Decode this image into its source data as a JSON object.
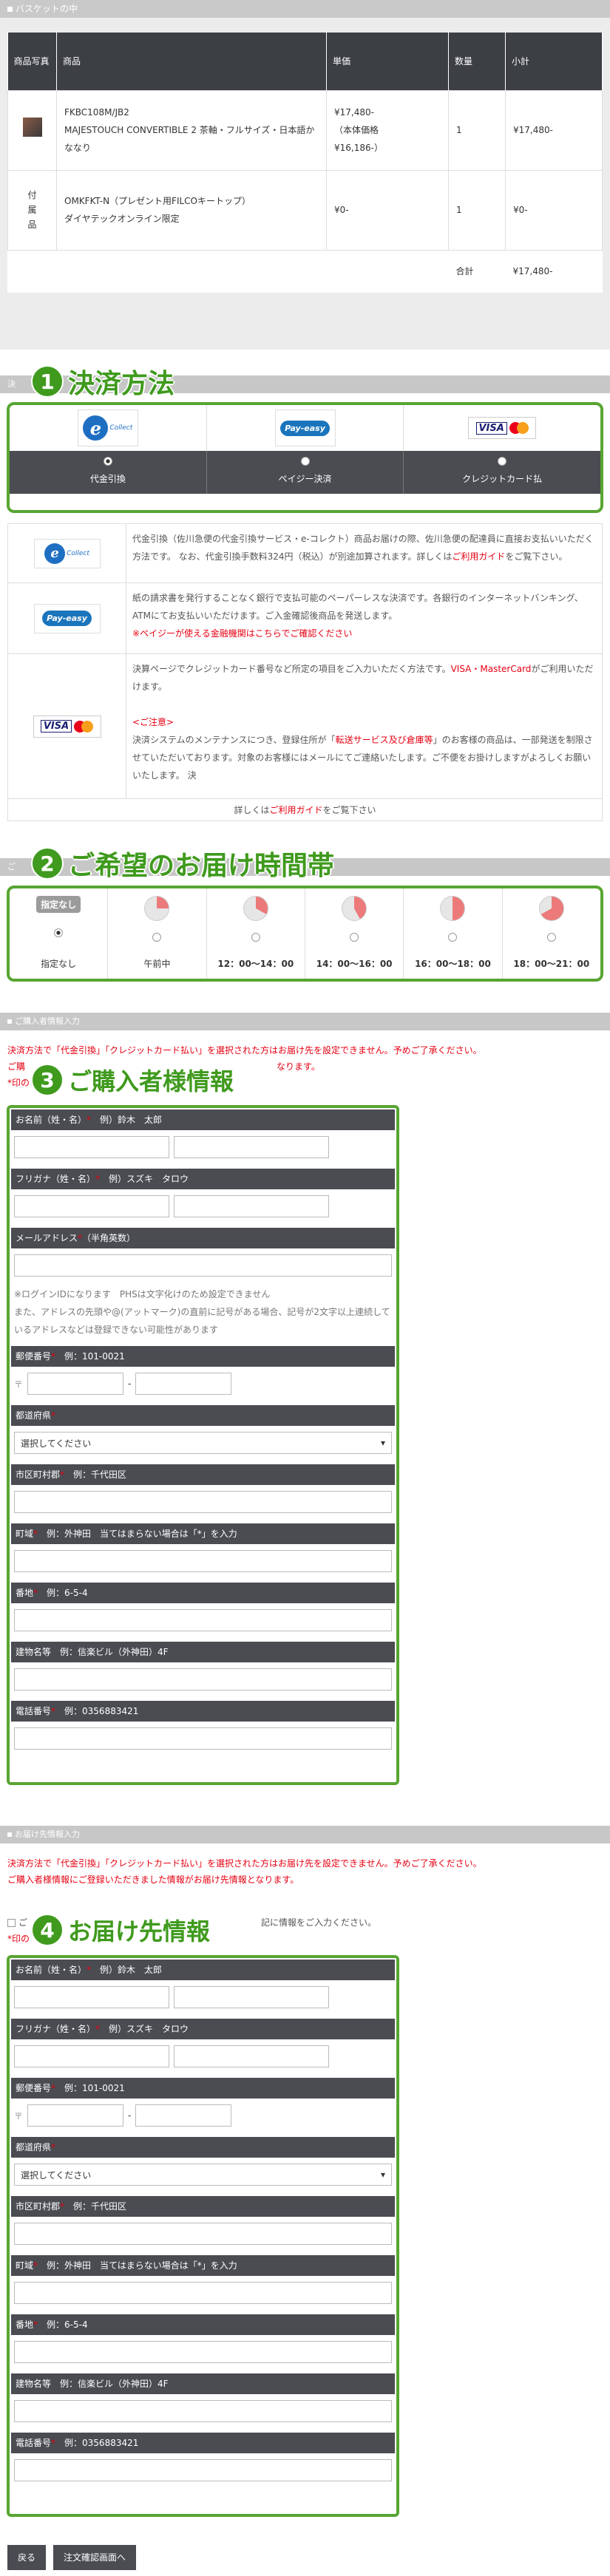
{
  "basket": {
    "section_title": "バスケットの中",
    "columns": [
      "商品写真",
      "商品",
      "単価",
      "数量",
      "小計"
    ],
    "items": [
      {
        "name": "FKBC108M/JB2\nMAJESTOUCH CONVERTIBLE 2 茶軸・フルサイズ・日本語かななり",
        "price": "¥17,480-\n（本体価格\n¥16,186-）",
        "qty": "1",
        "subtotal": "¥17,480-"
      },
      {
        "photo_label": "付\n属\n品",
        "name": "OMKFKT-N（プレゼント用FILCOキートップ）\nダイヤテックオンライン限定",
        "price": "¥0-",
        "qty": "1",
        "subtotal": "¥0-"
      }
    ],
    "total_label": "合計",
    "total_value": "¥17,480-"
  },
  "payment": {
    "number": "1",
    "heading": "決済方法",
    "strip_label": "決",
    "options": [
      {
        "label": "代金引換",
        "selected": true
      },
      {
        "label": "ペイジー決済",
        "selected": false
      },
      {
        "label": "クレジットカード払",
        "selected": false
      }
    ],
    "logos": {
      "ecollect": "e",
      "ecollect_text": "Collect",
      "payeasy": "Pay-easy",
      "visa": "VISA",
      "mastercard": "MasterCard"
    },
    "info": [
      {
        "text": "代金引換（佐川急便の代金引換サービス・e-コレクト）商品お届けの際、佐川急便の配達員に直接お支払いいただく方法です。 なお、代金引換手数料324円（税込）が別途加算されます。詳しくは",
        "link": "ご利用ガイド",
        "after": "をご覧下さい。"
      },
      {
        "text": "紙の請求書を発行することなく銀行で支払可能のペーパーレスな決済です。各銀行のインターネットバンキング、ATMにてお支払いいただけます。ご入金確認後商品を発送します。",
        "red": "※ペイジーが使える金融機関はこちらでご確認ください"
      },
      {
        "text": "決算ページでクレジットカード番号など所定の項目をご入力いただく方法です。",
        "red_brand": "VISA・MasterCard",
        "after": "がご利用いただけます。",
        "note_title": "<ご注意>",
        "note_text_a": "決済システムのメンテナンスにつき、登録住所が「",
        "note_red": "転送サービス及び倉庫等",
        "note_text_b": "」のお客様の商品は、一部発送を制限させていただいております。対象のお客様にはメールにてご連絡いたします。ご不便をお掛けしますがよろしくお願いいたします。 決"
      }
    ],
    "footer_pre": "詳しくは",
    "footer_link": "ご利用ガイド",
    "footer_post": "をご覧下さい"
  },
  "delivery": {
    "number": "2",
    "heading": "ご希望のお届け時間帯",
    "strip_label": "ご",
    "slots": [
      {
        "label": "指定なし",
        "badge": "指定なし",
        "selected": true,
        "pie": 0
      },
      {
        "label": "午前中",
        "selected": false,
        "pie": 0.25
      },
      {
        "label": "12：00〜14：00",
        "selected": false,
        "pie": 0.33
      },
      {
        "label": "14：00〜16：00",
        "selected": false,
        "pie": 0.42
      },
      {
        "label": "16：00〜18：00",
        "selected": false,
        "pie": 0.5
      },
      {
        "label": "18：00〜21：00",
        "selected": false,
        "pie": 0.67
      }
    ]
  },
  "buyer": {
    "section_title": "ご購入者情報入力",
    "number": "3",
    "heading": "ご購入者様情報",
    "notice_1": "決済方法で「代金引換」「クレジットカード払い」を選択された方はお届け先を設定できません。予めご了承ください。",
    "notice_2a": "ご購",
    "notice_2b": "なります。",
    "notice_3": "*印の",
    "name_label": "お名前（姓・名）",
    "name_example": "例）鈴木　太郎",
    "kana_label": "フリガナ（姓・名）",
    "kana_example": "例）スズキ　タロウ",
    "email_label": "メールアドレス",
    "email_hint": "（半角英数）",
    "email_note": "※ログインIDになります　PHSは文字化けのため設定できません\nまた、アドレスの先頭や@(アットマーク)の直前に記号がある場合、記号が2文字以上連続しているアドレスなどは登録できない可能性があります",
    "zip_label": "郵便番号",
    "zip_example": "例：101-0021",
    "pref_label": "都道府県",
    "pref_value": "選択してください",
    "city_label": "市区町村郡",
    "city_example": "例：千代田区",
    "town_label": "町域",
    "town_example": "例：外神田　当てはまらない場合は「*」を入力",
    "banchi_label": "番地",
    "banchi_example": "例：6-5-4",
    "building_label": "建物名等",
    "building_example": "例：信楽ビル（外神田）4F",
    "tel_label": "電話番号",
    "tel_example": "例：0356883421",
    "req_mark": "*",
    "zip_sep": "-",
    "zip_prefix": "〒"
  },
  "shipping": {
    "section_title": "お届け先情報入力",
    "number": "4",
    "heading": "お届け先情報",
    "notice_1": "決済方法で「代金引換」「クレジットカード払い」を選択された方はお届け先を設定できません。予めご了承ください。",
    "notice_2": "ご購入者様情報にご登録いただきました情報がお届け先情報となります。",
    "checkbox_pre": "ご",
    "checkbox_text": "記に情報をご入力ください。",
    "notice_3": "*印の"
  },
  "buttons": {
    "back": "戻る",
    "confirm": "注文確認画面へ"
  },
  "colors": {
    "accent": "#3f9a1d",
    "header": "#4a4c52",
    "required": "#e60012"
  }
}
